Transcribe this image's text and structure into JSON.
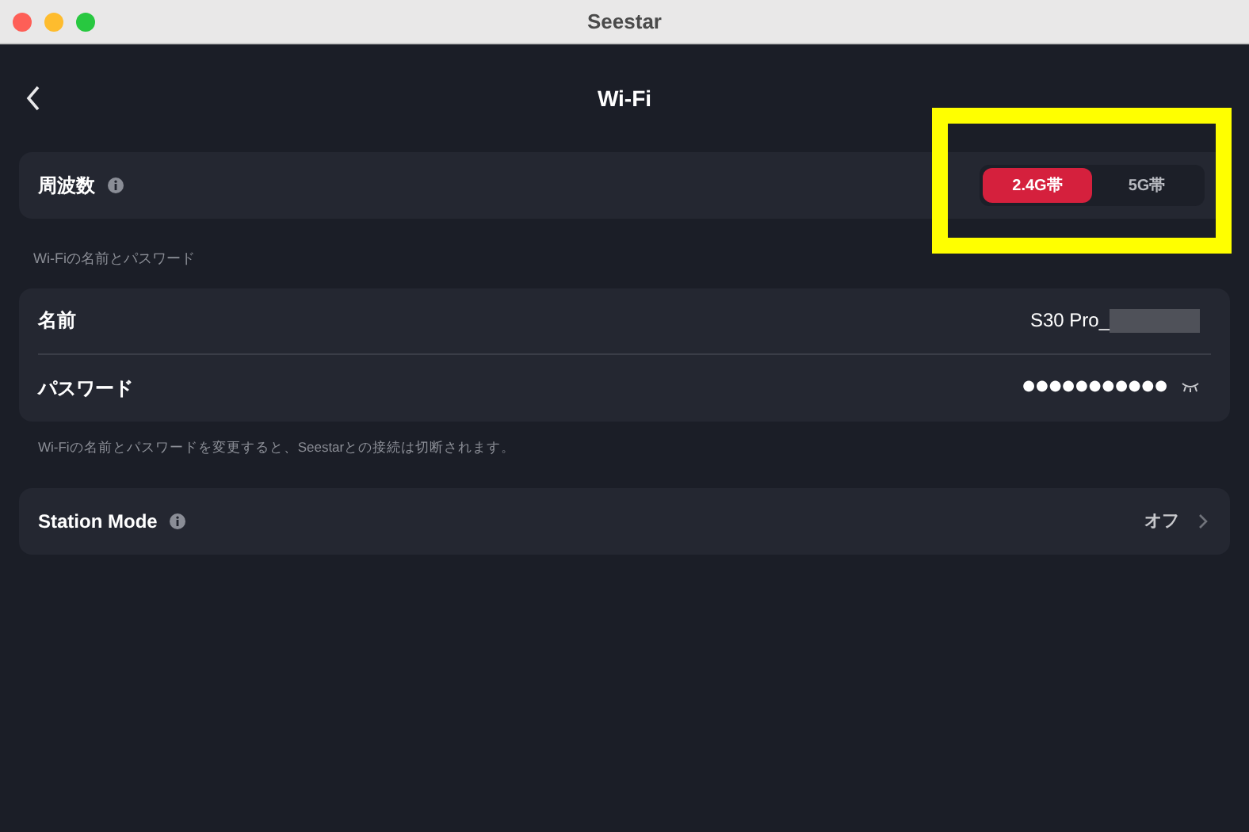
{
  "window": {
    "title": "Seestar"
  },
  "header": {
    "title": "Wi-Fi"
  },
  "frequency": {
    "label": "周波数",
    "options": [
      {
        "label": "2.4G帯",
        "selected": true
      },
      {
        "label": "5G帯",
        "selected": false
      }
    ]
  },
  "credentials": {
    "section_title": "Wi-Fiの名前とパスワード",
    "name": {
      "label": "名前",
      "value": "S30 Pro_"
    },
    "password": {
      "label": "パスワード",
      "value": "●●●●●●●●●●●"
    },
    "note": "Wi-Fiの名前とパスワードを変更すると、Seestarとの接続は切断されます。"
  },
  "station_mode": {
    "label": "Station Mode",
    "value": "オフ"
  }
}
